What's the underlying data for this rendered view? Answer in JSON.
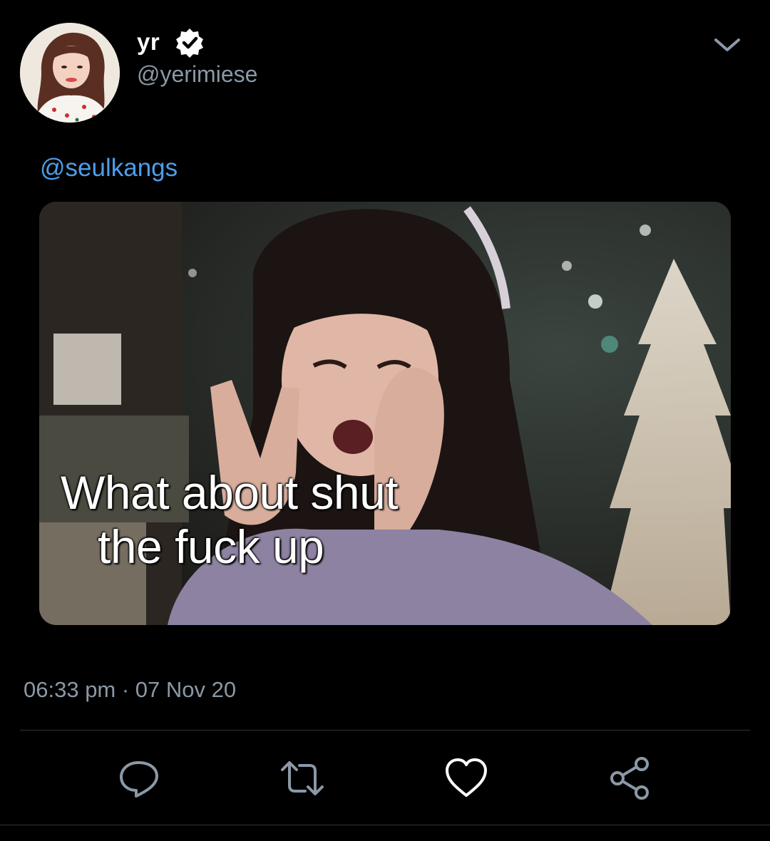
{
  "tweet": {
    "author": {
      "display_name": "yr",
      "handle": "@yerimiese",
      "verified": true,
      "avatar_icon": "avatar-image"
    },
    "mention": "@seulkangs",
    "media": {
      "caption_line1": "What about shut",
      "caption_line2": "the fuck up"
    },
    "timestamp": "06:33 pm · 07 Nov 20",
    "actions": {
      "reply_icon": "reply-icon",
      "retweet_icon": "retweet-icon",
      "like_icon": "heart-icon",
      "share_icon": "share-icon"
    },
    "colors": {
      "background": "#000000",
      "accent": "#4c9eeb",
      "secondary_text": "#8b98a5",
      "primary_text": "#ffffff",
      "divider": "#2f3336"
    }
  }
}
